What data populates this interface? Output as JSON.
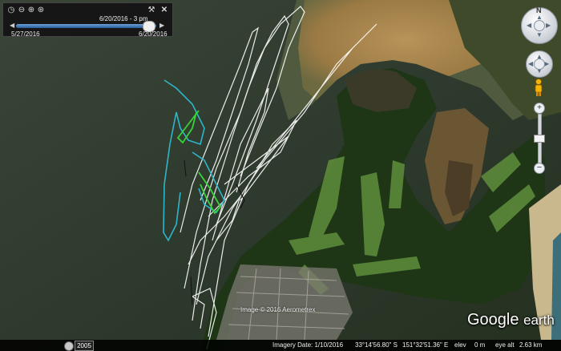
{
  "time_slider": {
    "current_date": "6/20/2016 - 3 pm",
    "start_date": "5/27/2016",
    "end_date": "6/20/2016",
    "position": 0.98
  },
  "nav": {
    "north_label": "N"
  },
  "historical_imagery": {
    "year": "2005"
  },
  "copyright": "Image © 2016 Aerometrex",
  "logo": {
    "brand": "Google",
    "product": "earth"
  },
  "status": {
    "imagery_date": "Imagery Date: 1/10/2016",
    "latitude": "33°14'56.80\" S",
    "longitude": "151°32'51.36\" E",
    "elev_label": "elev",
    "elev_value": "0 m",
    "eye_alt_label": "eye alt",
    "eye_alt_value": "2.63 km"
  },
  "colors": {
    "water": "#2e3b2e",
    "sand": "#a8854b",
    "forest": "#1f3a18",
    "fairway": "#5f8a3b",
    "track_white": "#ffffff",
    "track_cyan": "#2fb5c9",
    "track_green": "#38d23a"
  }
}
